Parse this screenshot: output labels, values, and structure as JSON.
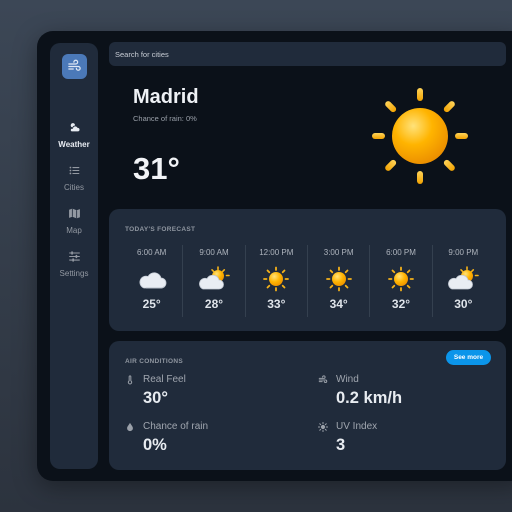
{
  "search": {
    "placeholder": "Search for cities"
  },
  "sidebar": {
    "items": [
      {
        "label": "Weather",
        "icon": "weather-icon",
        "active": true
      },
      {
        "label": "Cities",
        "icon": "list-icon"
      },
      {
        "label": "Map",
        "icon": "map-icon"
      },
      {
        "label": "Settings",
        "icon": "sliders-icon"
      }
    ]
  },
  "current": {
    "city": "Madrid",
    "rain": "Chance of rain: 0%",
    "temperature": "31°",
    "condition_icon": "sun-icon"
  },
  "forecast": {
    "title": "TODAY'S FORECAST",
    "hours": [
      {
        "time": "6:00 AM",
        "icon": "cloud-icon",
        "temp": "25°"
      },
      {
        "time": "9:00 AM",
        "icon": "partly-cloudy-icon",
        "temp": "28°"
      },
      {
        "time": "12:00 PM",
        "icon": "sun-icon",
        "temp": "33°"
      },
      {
        "time": "3:00 PM",
        "icon": "sun-icon",
        "temp": "34°"
      },
      {
        "time": "6:00 PM",
        "icon": "sun-icon",
        "temp": "32°"
      },
      {
        "time": "9:00 PM",
        "icon": "partly-cloudy-icon",
        "temp": "30°"
      }
    ]
  },
  "air": {
    "title": "AIR CONDITIONS",
    "see_more": "See more",
    "real_feel": {
      "label": "Real Feel",
      "value": "30°"
    },
    "wind": {
      "label": "Wind",
      "value": "0.2 km/h"
    },
    "rain": {
      "label": "Chance of rain",
      "value": "0%"
    },
    "uv": {
      "label": "UV Index",
      "value": "3"
    }
  },
  "colors": {
    "background": "#0b1119",
    "panel": "#202b3b",
    "accent": "#0b95ea",
    "sun": "#f5a300"
  }
}
